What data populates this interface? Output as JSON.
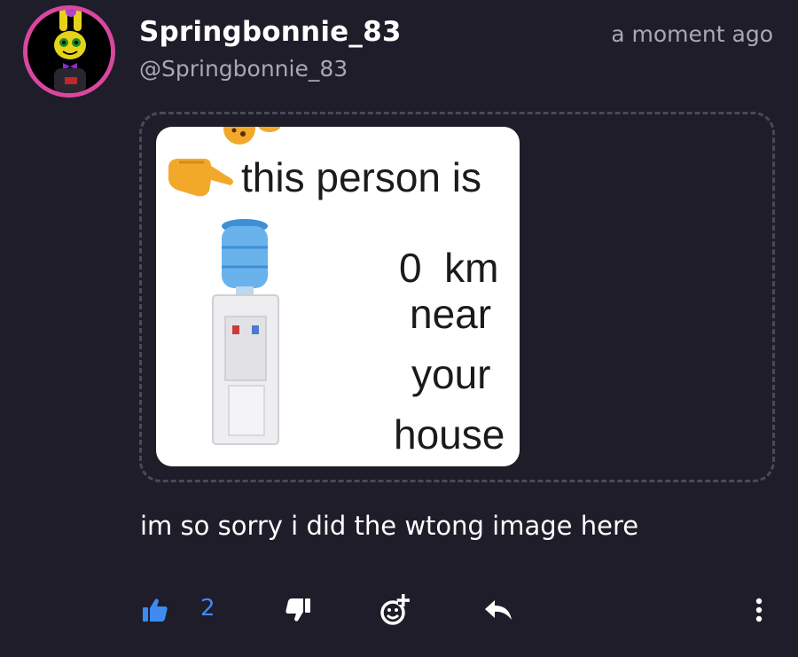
{
  "author": {
    "name": "Springbonnie_83",
    "handle": "@Springbonnie_83",
    "avatar_icon": "springbonnie-avatar",
    "avatar_ring_color": "#d9479e"
  },
  "timestamp": "a moment ago",
  "embed": {
    "meme_text": {
      "line1": "this person is",
      "line2": "0  km",
      "line3": "near",
      "line4": "your",
      "line5": "house"
    }
  },
  "caption": "im so sorry i did the wtong image here",
  "actions": {
    "like_count": "2",
    "like_color": "#3d8bf0",
    "icons": [
      "thumbs-up-icon",
      "thumbs-down-icon",
      "add-reaction-icon",
      "reply-icon",
      "more-vertical-icon"
    ]
  },
  "colors": {
    "background": "#1e1d29",
    "muted_text": "#a9a8b2",
    "accent": "#3d8bf0"
  }
}
